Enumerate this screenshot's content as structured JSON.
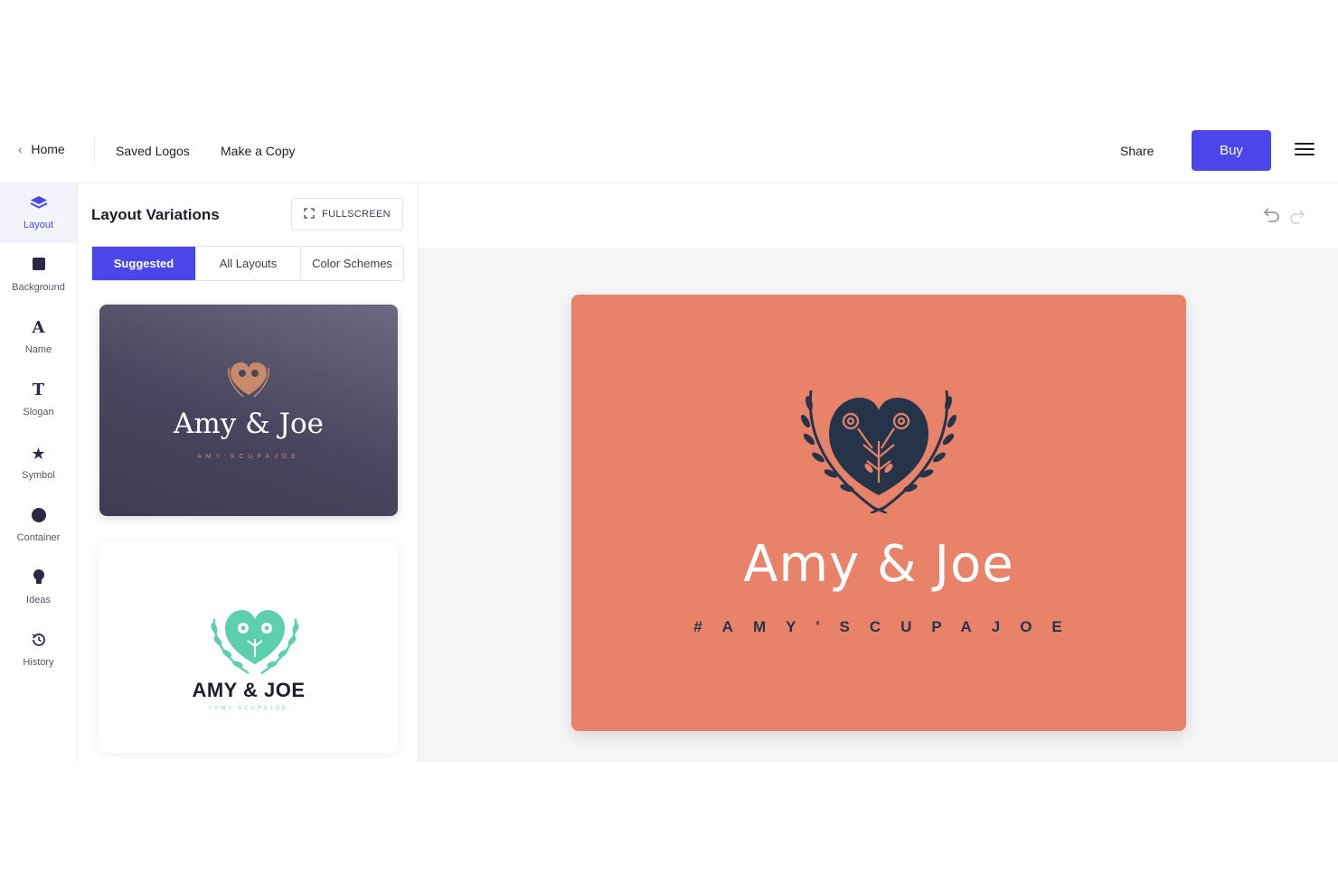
{
  "header": {
    "home_label": "Home",
    "saved_logos_label": "Saved Logos",
    "make_copy_label": "Make a Copy",
    "share_label": "Share",
    "buy_label": "Buy"
  },
  "sidebar": {
    "items": [
      {
        "label": "Layout",
        "icon": "layers-icon"
      },
      {
        "label": "Background",
        "icon": "square-icon"
      },
      {
        "label": "Name",
        "icon": "letter-a-icon"
      },
      {
        "label": "Slogan",
        "icon": "letter-t-icon"
      },
      {
        "label": "Symbol",
        "icon": "star-icon"
      },
      {
        "label": "Container",
        "icon": "circle-icon"
      },
      {
        "label": "Ideas",
        "icon": "lightbulb-icon"
      },
      {
        "label": "History",
        "icon": "history-icon"
      }
    ]
  },
  "panel": {
    "title": "Layout Variations",
    "fullscreen_label": "FULLSCREEN",
    "tabs": [
      {
        "label": "Suggested",
        "active": true
      },
      {
        "label": "All Layouts",
        "active": false
      },
      {
        "label": "Color Schemes",
        "active": false
      }
    ],
    "variations": [
      {
        "title": "Amy & Joe",
        "slogan": "AMY'SCUPAJOE",
        "background": "#47465e",
        "symbol_color": "#c98a6a"
      },
      {
        "title": "AMY & JOE",
        "slogan": "#AMY'SCUPAJOE",
        "background": "#ffffff",
        "symbol_color": "#5ccfae"
      }
    ]
  },
  "preview": {
    "title": "Amy & Joe",
    "slogan": "#AMY'SCUPAJOE",
    "background": "#e8836a",
    "symbol_color": "#26344a"
  },
  "colors": {
    "accent": "#4a46e9"
  }
}
